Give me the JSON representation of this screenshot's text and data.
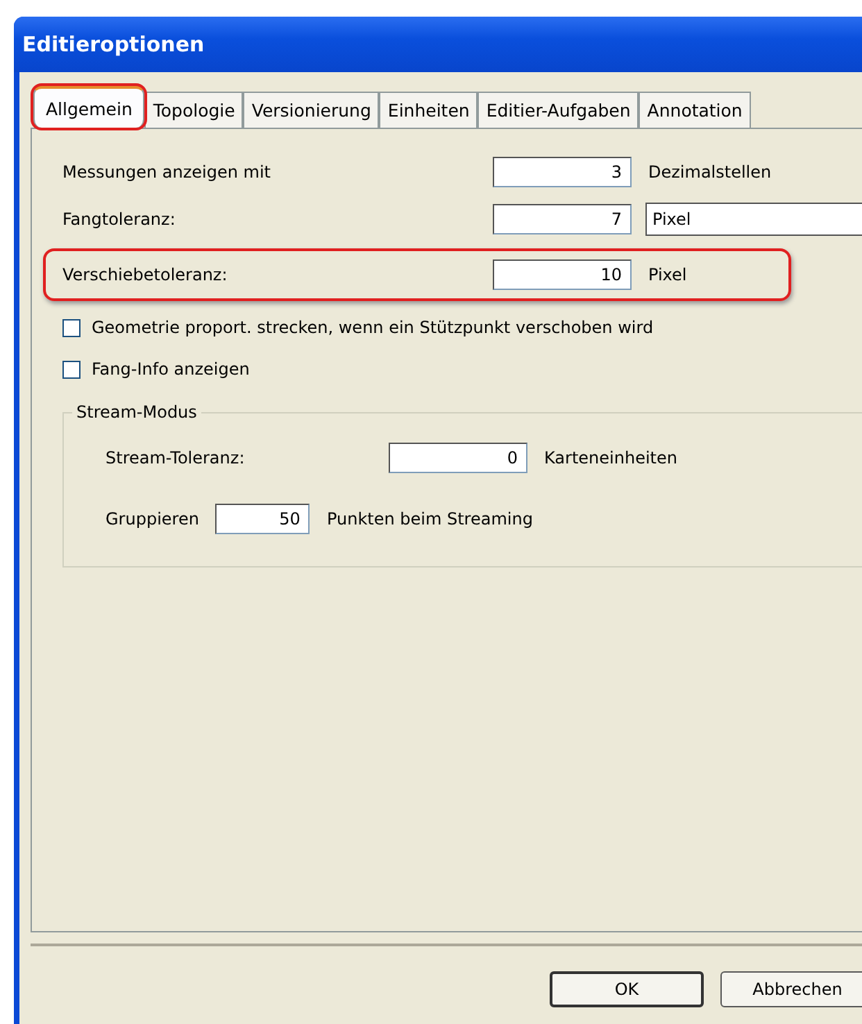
{
  "window": {
    "title": "Editieroptionen"
  },
  "tabs": [
    {
      "label": "Allgemein",
      "selected": true,
      "highlighted": true
    },
    {
      "label": "Topologie",
      "selected": false,
      "highlighted": false
    },
    {
      "label": "Versionierung",
      "selected": false,
      "highlighted": false
    },
    {
      "label": "Einheiten",
      "selected": false,
      "highlighted": false
    },
    {
      "label": "Editier-Aufgaben",
      "selected": false,
      "highlighted": false
    },
    {
      "label": "Annotation",
      "selected": false,
      "highlighted": false
    }
  ],
  "rows": [
    {
      "label": "Messungen anzeigen mit",
      "value": "3",
      "unit": "Dezimalstellen",
      "highlighted": false
    },
    {
      "label": "Fangtoleranz:",
      "value": "7",
      "unit_field": "Pixel",
      "highlighted": false
    },
    {
      "label": "Verschiebetoleranz:",
      "value": "10",
      "unit": "Pixel",
      "highlighted": true
    }
  ],
  "checkboxes": [
    {
      "label": "Geometrie proport. strecken, wenn ein Stützpunkt verschoben wird",
      "checked": false
    },
    {
      "label": "Fang-Info anzeigen",
      "checked": false
    }
  ],
  "stream_group": {
    "title": "Stream-Modus",
    "tolerance_label": "Stream-Toleranz:",
    "tolerance_value": "0",
    "tolerance_unit": "Karteneinheiten",
    "group_label": "Gruppieren",
    "group_value": "50",
    "group_unit": "Punkten beim Streaming"
  },
  "buttons": [
    "OK",
    "Abbrechen"
  ]
}
